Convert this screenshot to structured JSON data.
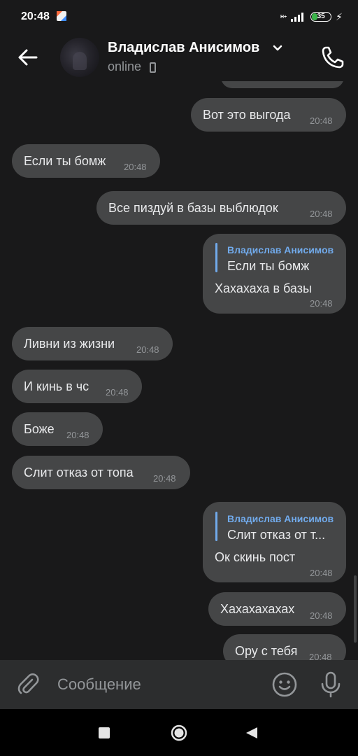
{
  "statusbar": {
    "time": "20:48",
    "network": "H+",
    "battery": "35",
    "battery_level_percent": 35
  },
  "header": {
    "name": "Владислав Анисимов",
    "status": "online"
  },
  "messages": [
    {
      "side": "out",
      "text": "Вот это выгода",
      "time": "20:48"
    },
    {
      "side": "in",
      "text": "Если ты бомж",
      "time": "20:48"
    },
    {
      "side": "out",
      "text": "Все пиздуй в базы выблюдок",
      "time": "20:48"
    },
    {
      "side": "out",
      "reply_author": "Владислав Анисимов",
      "reply_text": "Если ты бомж",
      "text": "Хахахаха в базы",
      "time": "20:48"
    },
    {
      "side": "in",
      "text": "Ливни из жизни",
      "time": "20:48"
    },
    {
      "side": "in",
      "text": "И кинь в чс",
      "time": "20:48"
    },
    {
      "side": "in",
      "text": "Боже",
      "time": "20:48"
    },
    {
      "side": "in",
      "text": "Слит отказ от топа",
      "time": "20:48"
    },
    {
      "side": "out",
      "reply_author": "Владислав Анисимов",
      "reply_text": "Слит отказ от т...",
      "text": "Ок скинь пост",
      "time": "20:48"
    },
    {
      "side": "out",
      "text": "Хахахахахах",
      "time": "20:48"
    },
    {
      "side": "out",
      "text": "Ору с тебя",
      "time": "20:48"
    }
  ],
  "composer": {
    "placeholder": "Сообщение"
  },
  "colors": {
    "background": "#19191a",
    "bubble": "#454647",
    "accent": "#71aaeb",
    "secondary_text": "#939699",
    "battery_green": "#3bb54a"
  },
  "icons": [
    "back-arrow-icon",
    "chevron-down-icon",
    "call-icon",
    "attach-icon",
    "emoji-icon",
    "mic-icon",
    "nav-recents-icon",
    "nav-home-icon",
    "nav-back-icon"
  ]
}
